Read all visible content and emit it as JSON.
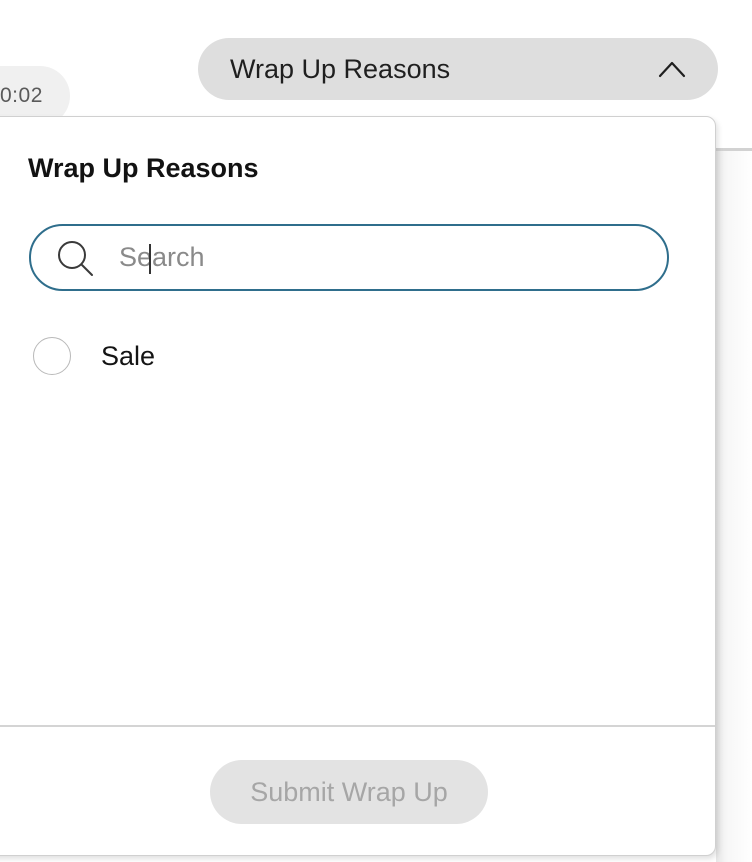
{
  "timer": {
    "text": "0:02"
  },
  "dropdown": {
    "label": "Wrap Up Reasons",
    "expanded": true
  },
  "panel": {
    "title": "Wrap Up Reasons",
    "search": {
      "value": "",
      "placeholder": "Search"
    },
    "options": [
      {
        "label": "Sale",
        "selected": false
      }
    ],
    "submit_label": "Submit Wrap Up",
    "submit_disabled": true
  },
  "colors": {
    "search_border": "#2f6e8c",
    "toggle_bg": "#dedede",
    "submit_bg": "#e3e3e3",
    "submit_text": "#a6a6a6"
  },
  "icons": {
    "dropdown": "chevron-up-icon",
    "search": "search-icon",
    "option": "radio-icon"
  }
}
